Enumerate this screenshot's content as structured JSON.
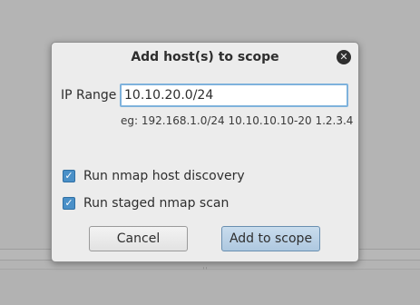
{
  "dialog": {
    "title": "Add host(s) to scope",
    "close_icon": "close-icon",
    "ip_range": {
      "label": "IP Range",
      "value": "10.10.20.0/24",
      "hint": "eg: 192.168.1.0/24 10.10.10.10-20 1.2.3.4"
    },
    "options": [
      {
        "label": "Run nmap host discovery",
        "checked": true
      },
      {
        "label": "Run staged nmap scan",
        "checked": true
      }
    ],
    "buttons": {
      "cancel": "Cancel",
      "add": "Add to scope"
    }
  },
  "colors": {
    "dialog_bg": "#ececec",
    "accent": "#4a90c8",
    "input_focus_border": "#7eb2dc",
    "primary_button": "#aec8e0"
  }
}
